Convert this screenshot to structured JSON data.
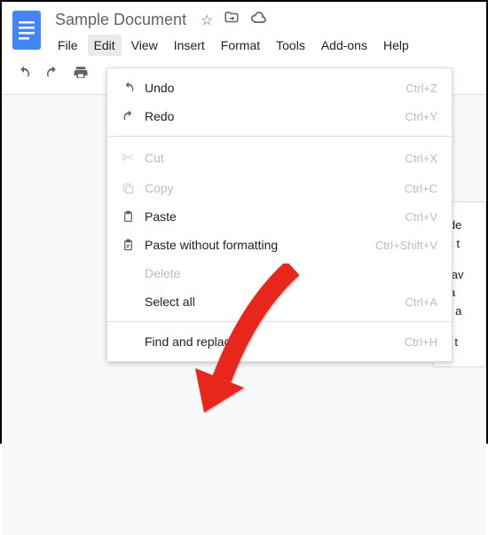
{
  "header": {
    "title": "Sample Document"
  },
  "menubar": {
    "items": [
      {
        "label": "File"
      },
      {
        "label": "Edit"
      },
      {
        "label": "View"
      },
      {
        "label": "Insert"
      },
      {
        "label": "Format"
      },
      {
        "label": "Tools"
      },
      {
        "label": "Add-ons"
      },
      {
        "label": "Help"
      }
    ]
  },
  "dropdown": {
    "items": [
      {
        "label": "Undo",
        "shortcut": "Ctrl+Z"
      },
      {
        "label": "Redo",
        "shortcut": "Ctrl+Y"
      },
      {
        "label": "Cut",
        "shortcut": "Ctrl+X"
      },
      {
        "label": "Copy",
        "shortcut": "Ctrl+C"
      },
      {
        "label": "Paste",
        "shortcut": "Ctrl+V"
      },
      {
        "label": "Paste without formatting",
        "shortcut": "Ctrl+Shift+V"
      },
      {
        "label": "Delete",
        "shortcut": ""
      },
      {
        "label": "Select all",
        "shortcut": "Ctrl+A"
      },
      {
        "label": "Find and replace",
        "shortcut": "Ctrl+H"
      }
    ]
  },
  "page": {
    "line1": "o de",
    "line2": "ws t",
    "line3": "y fav",
    "line4": " tha",
    "line5": "er, a",
    "line6": "ns t"
  }
}
